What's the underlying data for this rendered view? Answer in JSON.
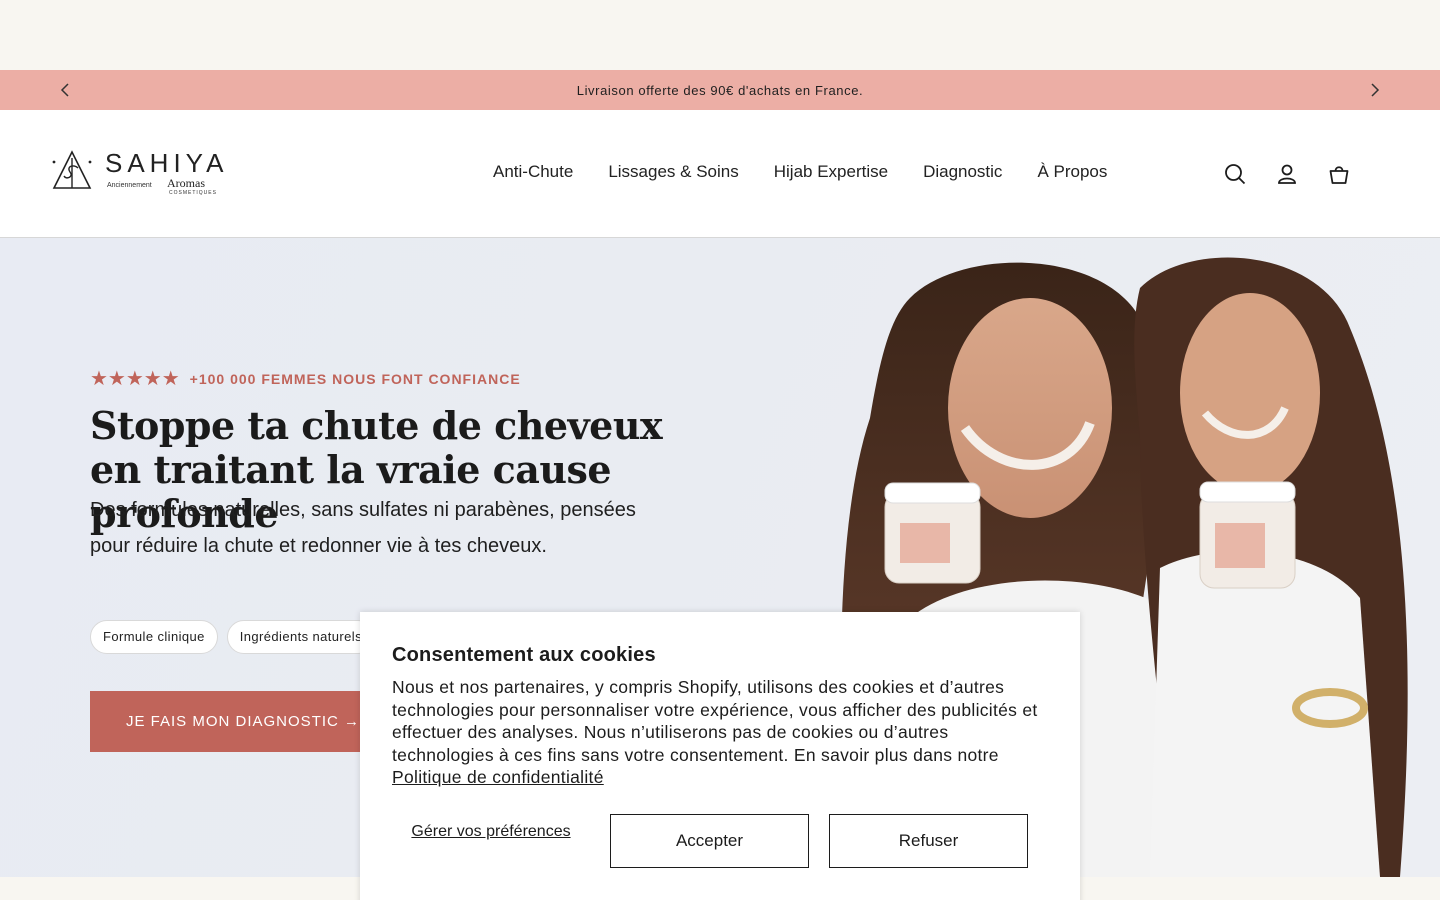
{
  "announcement": {
    "text": "Livraison offerte des 90€ d'achats en France.",
    "prev_icon": "chevron-left-icon",
    "next_icon": "chevron-right-icon"
  },
  "header": {
    "logo": {
      "name": "SAHIYA",
      "subline": "Anciennement",
      "former_brand": "Aromas",
      "former_brand_sub": "COSMETIQUES"
    },
    "nav": [
      "Anti-Chute",
      "Lissages & Soins",
      "Hijab Expertise",
      "Diagnostic",
      "À Propos"
    ],
    "icons": [
      "search-icon",
      "account-icon",
      "cart-icon"
    ]
  },
  "hero": {
    "stars": "★★★★★",
    "rating_text": "+100 000 FEMMES NOUS FONT CONFIANCE",
    "title": "Stoppe ta chute de cheveux en traitant la vraie cause profonde",
    "subtitle": "Des formules naturelles, sans sulfates ni parabènes, pensées pour réduire la chute et redonner vie à tes cheveux.",
    "pills": [
      "Formule clinique",
      "Ingrédients naturels"
    ],
    "cta": "JE FAIS MON DIAGNOSTIC →"
  },
  "cookie_banner": {
    "title": "Consentement aux cookies",
    "body": "Nous et nos partenaires, y compris Shopify, utilisons des cookies et d’autres technologies pour personnaliser votre expérience, vous afficher des publicités et effectuer des analyses. Nous n’utiliserons pas de cookies ou d’autres technologies à ces fins sans votre consentement. En savoir plus dans notre ",
    "link": "Politique de confidentialité",
    "manage": "Gérer vos préférences",
    "accept": "Accepter",
    "refuse": "Refuser"
  },
  "colors": {
    "announcement_bg": "#ecaea5",
    "accent": "#c0645a",
    "page_bg": "#f8f6f1",
    "hero_bg": "#e9ecf2"
  }
}
